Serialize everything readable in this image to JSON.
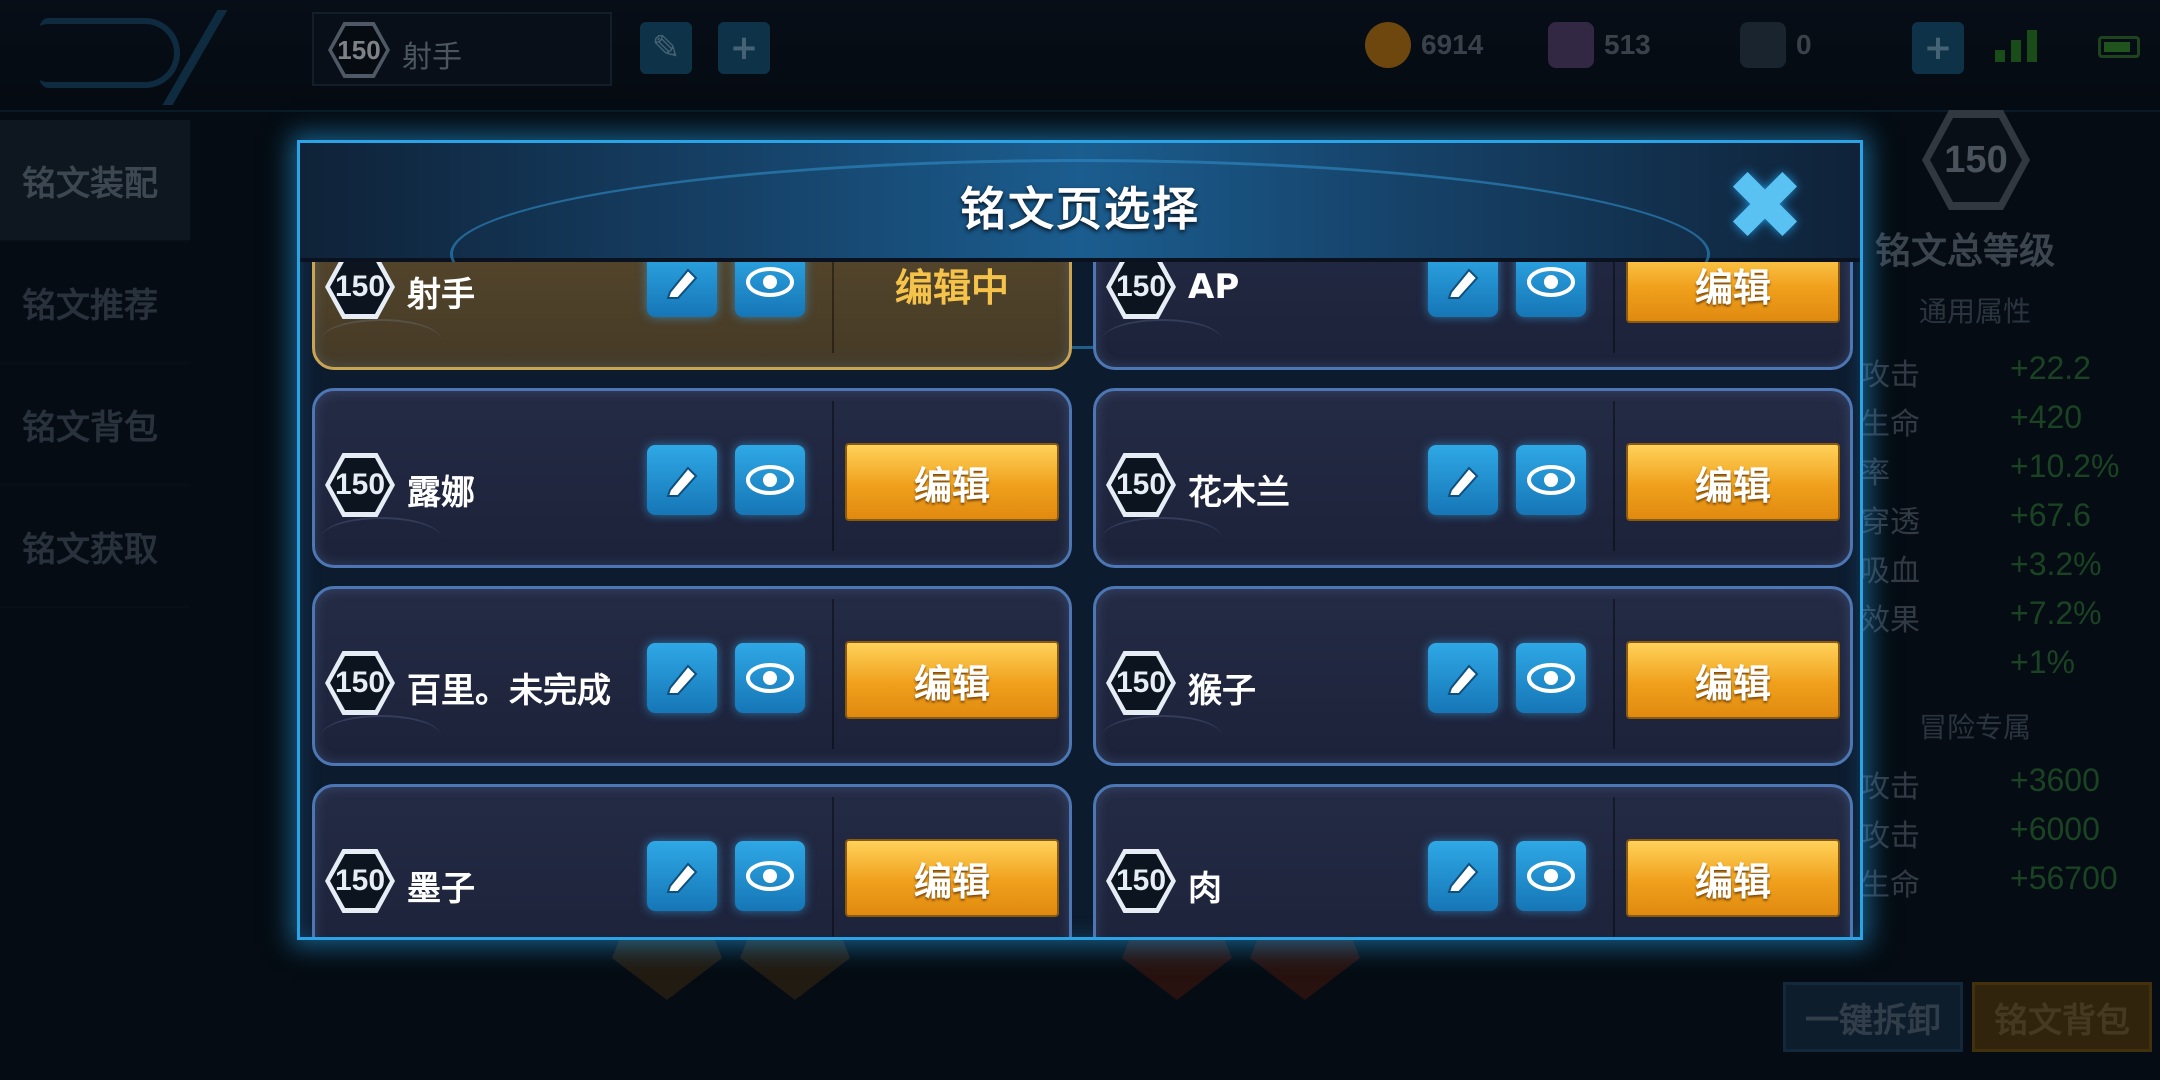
{
  "topbar": {
    "current_page": {
      "level": "150",
      "name": "射手"
    },
    "currencies": [
      {
        "icon": "gold-coin-icon",
        "value": "6914",
        "color": "#e09a1a"
      },
      {
        "icon": "diamond-icon",
        "value": "513",
        "color": "#8a6aa8"
      },
      {
        "icon": "voucher-icon",
        "value": "0",
        "color": "#4f6e88"
      }
    ],
    "add_symbol": "+"
  },
  "sidebar": {
    "items": [
      {
        "label": "铭文装配",
        "active": true
      },
      {
        "label": "铭文推荐",
        "active": false
      },
      {
        "label": "铭文背包",
        "active": false
      },
      {
        "label": "铭文获取",
        "active": false
      }
    ]
  },
  "right_panel": {
    "total_level": "150",
    "total_label": "铭文总等级",
    "general_title": "通用属性",
    "general_stats": [
      {
        "label": "攻击",
        "value": "+22.2"
      },
      {
        "label": "生命",
        "value": "+420"
      },
      {
        "label": "率",
        "value": "+10.2%"
      },
      {
        "label": "穿透",
        "value": "+67.6"
      },
      {
        "label": "吸血",
        "value": "+3.2%"
      },
      {
        "label": "效果",
        "value": "+7.2%"
      },
      {
        "label": "",
        "value": "+1%"
      }
    ],
    "adventure_title": "冒险专属",
    "adventure_stats": [
      {
        "label": "攻击",
        "value": "+3600"
      },
      {
        "label": "攻击",
        "value": "+6000"
      },
      {
        "label": "生命",
        "value": "+56700"
      }
    ],
    "unload_button": "一键拆卸",
    "bag_button": "铭文背包"
  },
  "modal": {
    "title": "铭文页选择",
    "close_symbol": "✖",
    "pages": [
      {
        "level": "150",
        "name": "射手",
        "status": "编辑中",
        "selected": true
      },
      {
        "level": "150",
        "name": "AP",
        "status": "编辑",
        "selected": false
      },
      {
        "level": "150",
        "name": "露娜",
        "status": "编辑",
        "selected": false
      },
      {
        "level": "150",
        "name": "花木兰",
        "status": "编辑",
        "selected": false
      },
      {
        "level": "150",
        "name": "百里。未完成",
        "status": "编辑",
        "selected": false
      },
      {
        "level": "150",
        "name": "猴子",
        "status": "编辑",
        "selected": false
      },
      {
        "level": "150",
        "name": "墨子",
        "status": "编辑",
        "selected": false
      },
      {
        "level": "150",
        "name": "肉",
        "status": "编辑",
        "selected": false
      }
    ]
  }
}
